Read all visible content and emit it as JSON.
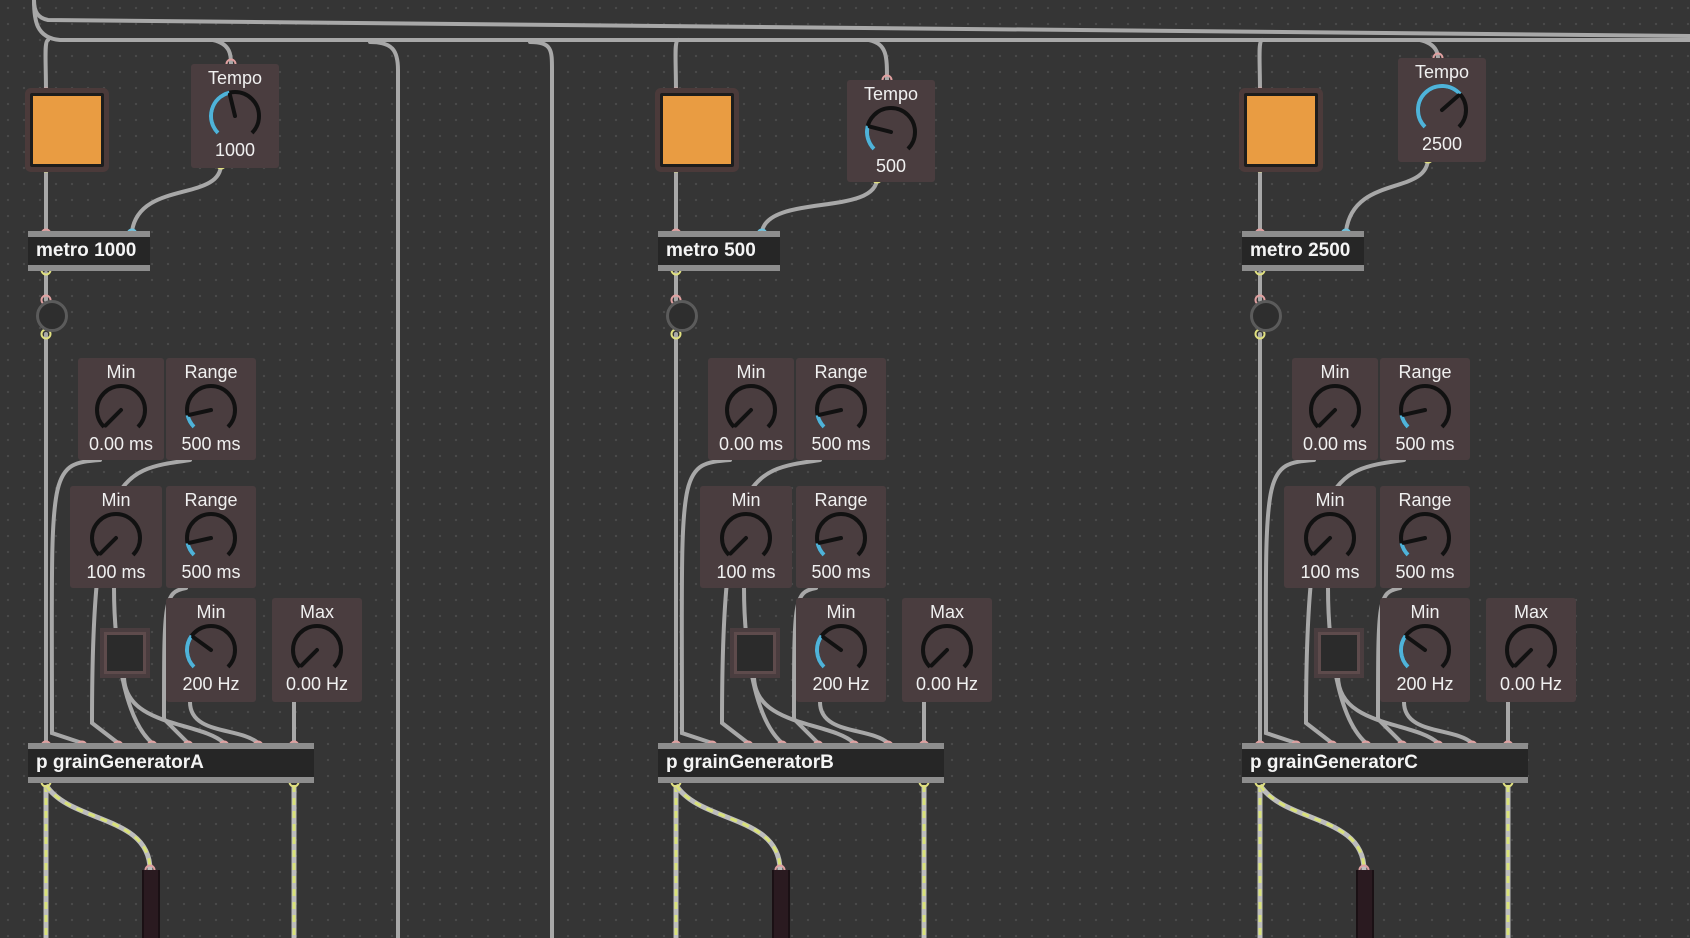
{
  "colors": {
    "background": "#353535",
    "toggle": "#e99c42",
    "dial_arc": "#4fb3d9",
    "cord": "#a8a8a8",
    "signal_cord": "#d9e27a",
    "inlet": "#e0a0a0",
    "outlet": "#e0e080"
  },
  "icons": {
    "knob": "dial-knob-icon",
    "toggle": "square-toggle-icon",
    "bang": "circle-bang-icon"
  },
  "columns": [
    {
      "id": "a",
      "tempo": {
        "label": "Tempo",
        "value": "1000",
        "level": 0.45
      },
      "metro": "metro 1000",
      "dials": [
        {
          "label": "Min",
          "value": "0.00 ms",
          "level": 0.0
        },
        {
          "label": "Range",
          "value": "500 ms",
          "level": 0.12
        },
        {
          "label": "Min",
          "value": "100 ms",
          "level": 0.0
        },
        {
          "label": "Range",
          "value": "500 ms",
          "level": 0.12
        },
        {
          "label": "Min",
          "value": "200 Hz",
          "level": 0.3
        },
        {
          "label": "Max",
          "value": "0.00 Hz",
          "level": 0.0
        }
      ],
      "generator": "p grainGeneratorA"
    },
    {
      "id": "b",
      "tempo": {
        "label": "Tempo",
        "value": "500",
        "level": 0.22
      },
      "metro": "metro 500",
      "dials": [
        {
          "label": "Min",
          "value": "0.00 ms",
          "level": 0.0
        },
        {
          "label": "Range",
          "value": "500 ms",
          "level": 0.12
        },
        {
          "label": "Min",
          "value": "100 ms",
          "level": 0.0
        },
        {
          "label": "Range",
          "value": "500 ms",
          "level": 0.12
        },
        {
          "label": "Min",
          "value": "200 Hz",
          "level": 0.3
        },
        {
          "label": "Max",
          "value": "0.00 Hz",
          "level": 0.0
        }
      ],
      "generator": "p grainGeneratorB"
    },
    {
      "id": "c",
      "tempo": {
        "label": "Tempo",
        "value": "2500",
        "level": 0.68
      },
      "metro": "metro 2500",
      "dials": [
        {
          "label": "Min",
          "value": "0.00 ms",
          "level": 0.0
        },
        {
          "label": "Range",
          "value": "500 ms",
          "level": 0.12
        },
        {
          "label": "Min",
          "value": "100 ms",
          "level": 0.0
        },
        {
          "label": "Range",
          "value": "500 ms",
          "level": 0.12
        },
        {
          "label": "Min",
          "value": "200 Hz",
          "level": 0.3
        },
        {
          "label": "Max",
          "value": "0.00 Hz",
          "level": 0.0
        }
      ],
      "generator": "p grainGeneratorC"
    }
  ]
}
